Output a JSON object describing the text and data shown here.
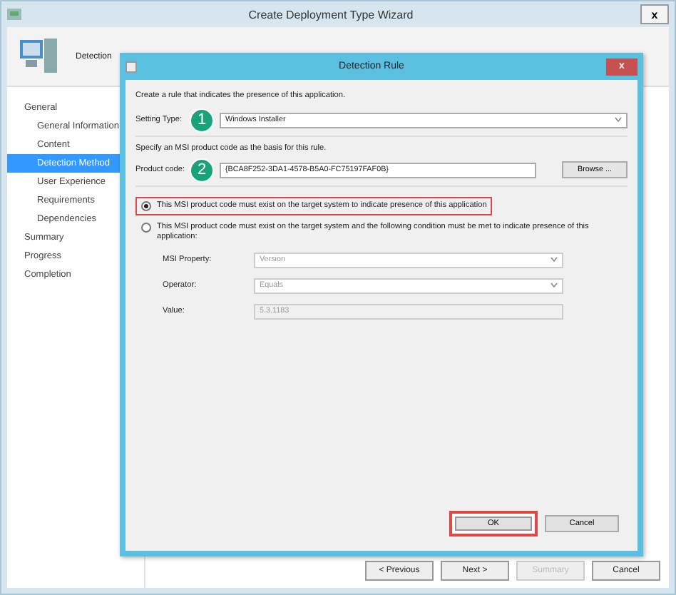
{
  "window": {
    "title": "Create Deployment Type Wizard",
    "close": "x"
  },
  "header": {
    "title": "Detection"
  },
  "sidebar": {
    "items": [
      {
        "label": "General",
        "selected": false,
        "children": [
          {
            "label": "General Information",
            "selected": false
          },
          {
            "label": "Content",
            "selected": false
          },
          {
            "label": "Detection Method",
            "selected": true
          },
          {
            "label": "User Experience",
            "selected": false
          },
          {
            "label": "Requirements",
            "selected": false
          },
          {
            "label": "Dependencies",
            "selected": false
          }
        ]
      },
      {
        "label": "Summary",
        "selected": false
      },
      {
        "label": "Progress",
        "selected": false
      },
      {
        "label": "Completion",
        "selected": false
      }
    ]
  },
  "wizard_buttons": [
    {
      "label": "< Previous",
      "disabled": false
    },
    {
      "label": "Next >",
      "disabled": false
    },
    {
      "label": "Summary",
      "disabled": true
    },
    {
      "label": "Cancel",
      "disabled": false
    }
  ],
  "dialog": {
    "title": "Detection Rule",
    "close": "x",
    "intro": "Create a rule that indicates the presence of this application.",
    "setting_type": {
      "label": "Setting Type:",
      "value": "Windows Installer",
      "step": "1"
    },
    "hint": "Specify an MSI product code as the basis for this rule.",
    "product_code": {
      "label": "Product code:",
      "value": "{BCA8F252-3DA1-4578-B5A0-FC75197FAF0B}",
      "step": "2",
      "browse": "Browse ..."
    },
    "options": [
      {
        "label": "This MSI product code must exist on the target system to indicate presence of this application",
        "selected": true,
        "highlighted": true
      },
      {
        "label": "This MSI product code must exist on the target system and the following condition must be met to indicate presence of this application:",
        "selected": false,
        "highlighted": false
      }
    ],
    "condition": [
      {
        "kind": "dropdown",
        "label": "MSI Property:",
        "value": "Version"
      },
      {
        "kind": "dropdown",
        "label": "Operator:",
        "value": "Equals"
      },
      {
        "kind": "text",
        "label": "Value:",
        "value": "5.3.1183"
      }
    ],
    "buttons": [
      {
        "label": "OK",
        "highlighted": true
      },
      {
        "label": "Cancel",
        "highlighted": false
      }
    ]
  }
}
